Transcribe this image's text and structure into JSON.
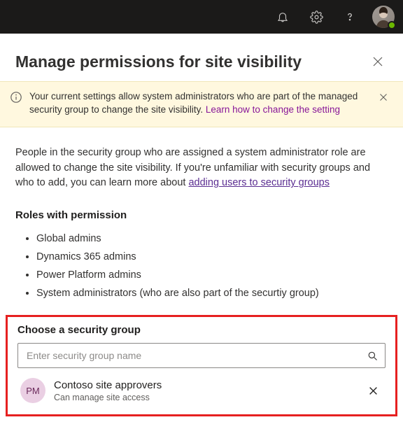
{
  "topbar": {
    "icons": [
      "bell",
      "settings",
      "help"
    ]
  },
  "header": {
    "title": "Manage permissions for site visibility"
  },
  "banner": {
    "text_a": "Your current settings allow system administrators who are part of the managed security group to change the site visibility. ",
    "link_text": "Learn how to change the setting"
  },
  "intro": {
    "text_a": "People in the security group who are assigned a system administrator role are allowed to change the site visibility. If you're unfamiliar with security groups and who to add, you can learn more about ",
    "link_text": "adding users to security groups"
  },
  "roles": {
    "heading": "Roles with permission",
    "items": [
      "Global admins",
      "Dynamics 365 admins",
      "Power Platform admins",
      "System administrators (who are also part of the securtiy group)"
    ]
  },
  "choose": {
    "heading": "Choose a security group",
    "placeholder": "Enter security group name"
  },
  "group": {
    "initials": "PM",
    "name": "Contoso site approvers",
    "sub": "Can manage site access"
  }
}
